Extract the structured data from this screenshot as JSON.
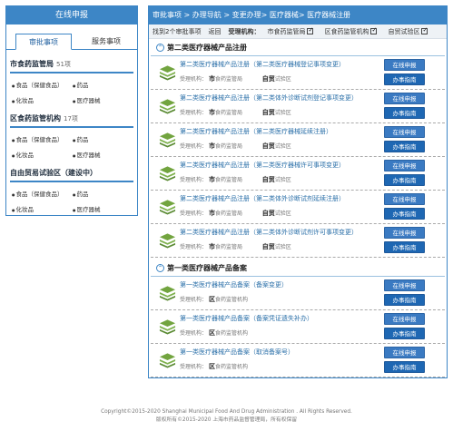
{
  "left": {
    "title": "在线申报",
    "tabs": [
      {
        "label": "审批事项"
      },
      {
        "label": "服务事项"
      }
    ],
    "groups": [
      {
        "title": "市食药监管局",
        "count": "51项",
        "items": [
          "食品（保健食品）",
          "药品",
          "化妆品",
          "医疗器械"
        ]
      },
      {
        "title": "区食药监管机构",
        "count": "17项",
        "items": [
          "食品（保健食品）",
          "药品",
          "化妆品",
          "医疗器械"
        ]
      },
      {
        "title": "自由贸易试验区（建设中）",
        "count": "",
        "items": [
          "食品（保健食品）",
          "药品",
          "化妆品",
          "医疗器械"
        ]
      }
    ]
  },
  "right": {
    "breadcrumb": "审批事项 > 办理导航 > 变更办理> 医疗器械> 医疗器械注册",
    "toolbar": {
      "found": "找到2个审批事项",
      "back": "返回",
      "org_label": "受理机构：",
      "filters": [
        "市食药监管局",
        "区食药监管机构",
        "自贸试验区"
      ]
    },
    "sections": [
      {
        "title": "第二类医疗器械产品注册",
        "items": [
          {
            "title": "第二类医疗器械产品注册（第二类医疗器械登记事项变更）",
            "sub_label": "受理机构：",
            "org1": "市",
            "org1_text": "食药监管局",
            "org2": "自贸",
            "org2_text": "试验区"
          },
          {
            "title": "第二类医疗器械产品注册（第二类体外诊断试剂登记事项变更）",
            "sub_label": "受理机构：",
            "org1": "市",
            "org1_text": "食药监管局",
            "org2": "自贸",
            "org2_text": "试验区"
          },
          {
            "title": "第二类医疗器械产品注册（第二类医疗器械延续注册）",
            "sub_label": "受理机构：",
            "org1": "市",
            "org1_text": "食药监管局",
            "org2": "自贸",
            "org2_text": "试验区"
          },
          {
            "title": "第二类医疗器械产品注册（第二类医疗器械许可事项变更）",
            "sub_label": "受理机构：",
            "org1": "市",
            "org1_text": "食药监管局",
            "org2": "自贸",
            "org2_text": "试验区"
          },
          {
            "title": "第二类医疗器械产品注册（第二类体外诊断试剂延续注册）",
            "sub_label": "受理机构：",
            "org1": "市",
            "org1_text": "食药监管局",
            "org2": "自贸",
            "org2_text": "试验区"
          },
          {
            "title": "第二类医疗器械产品注册（第二类体外诊断试剂许可事项变更）",
            "sub_label": "受理机构：",
            "org1": "市",
            "org1_text": "食药监管局",
            "org2": "自贸",
            "org2_text": "试验区"
          }
        ]
      },
      {
        "title": "第一类医疗器械产品备案",
        "items": [
          {
            "title": "第一类医疗器械产品备案（备案变更）",
            "sub_label": "受理机构：",
            "org1": "区",
            "org1_text": "食药监管机构",
            "org2": "",
            "org2_text": ""
          },
          {
            "title": "第一类医疗器械产品备案（备案凭证遗失补办）",
            "sub_label": "受理机构：",
            "org1": "区",
            "org1_text": "食药监管机构",
            "org2": "",
            "org2_text": ""
          },
          {
            "title": "第一类医疗器械产品备案（取消备案号）",
            "sub_label": "受理机构：",
            "org1": "区",
            "org1_text": "食药监管机构",
            "org2": "",
            "org2_text": ""
          }
        ]
      }
    ],
    "buttons": {
      "online": "在线申报",
      "guide": "办事指南"
    }
  },
  "footer": {
    "line1": "Copyright©2015-2020 Shanghai Municipal Food And Drug Administration . All Rights Reserved.",
    "line2": "版权所有©2015-2020 上海市药品监督管理局，所有权保留"
  },
  "colors": {
    "header_blue": "#3d86c6",
    "button_blue": "#3a7ac2"
  }
}
